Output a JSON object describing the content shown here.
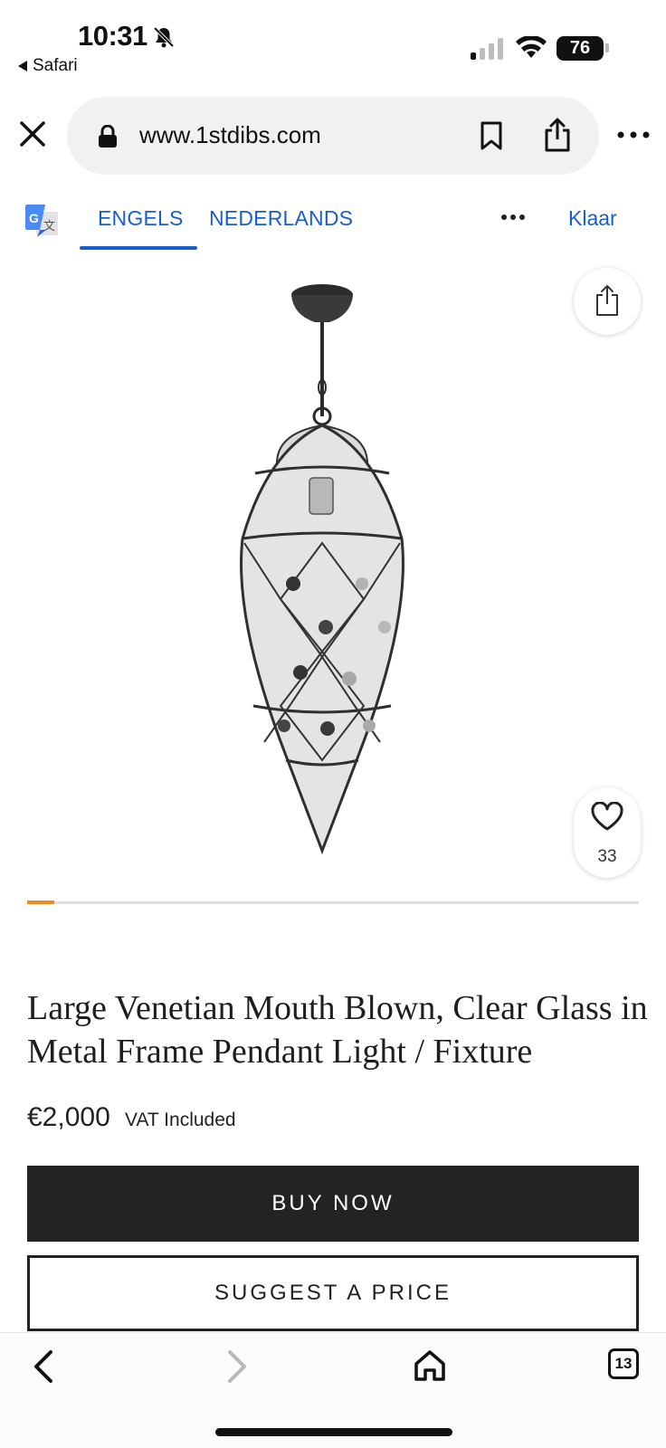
{
  "status_bar": {
    "time": "10:31",
    "back_app": "Safari",
    "battery": "76",
    "icons": [
      "bell-slash-icon",
      "signal-icon",
      "wifi-icon",
      "battery-icon"
    ]
  },
  "browser": {
    "url": "www.1stdibs.com",
    "icons": [
      "close-icon",
      "lock-icon",
      "bookmark-icon",
      "share-icon",
      "more-icon"
    ]
  },
  "translate_bar": {
    "tabs": [
      {
        "label": "ENGELS",
        "selected": true
      },
      {
        "label": "NEDERLANDS",
        "selected": false
      }
    ],
    "done_label": "Klaar"
  },
  "gallery": {
    "favorites_count": "33",
    "progress": 0.045
  },
  "product": {
    "title": "Large Venetian Mouth Blown, Clear Glass in Metal Frame Pendant Light / Fixture",
    "price": "€2,000",
    "vat": "VAT Included",
    "buy_label": "BUY NOW",
    "suggest_label": "SUGGEST A PRICE"
  },
  "toolbar": {
    "tab_count": "13"
  },
  "colors": {
    "accent_blue": "#1a5fc7",
    "progress_orange": "#ef8a1f",
    "button_dark": "#232323"
  }
}
